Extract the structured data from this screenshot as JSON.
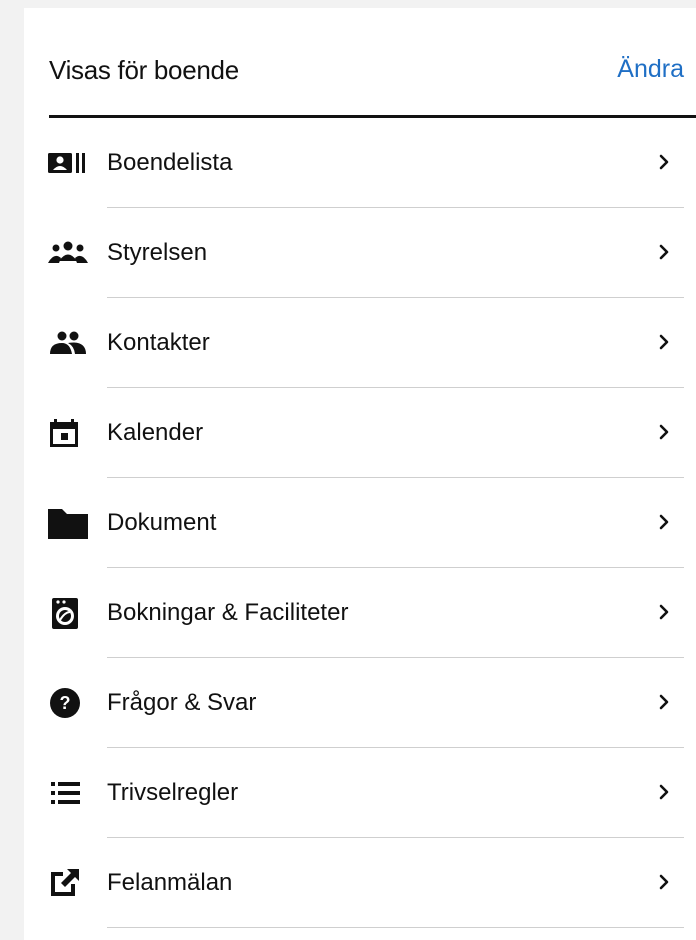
{
  "header": {
    "title": "Visas för boende",
    "action_label": "Ändra"
  },
  "accent_color": "#1f6fc5",
  "menu": [
    {
      "label": "Boendelista",
      "icon": "resident-list-icon"
    },
    {
      "label": "Styrelsen",
      "icon": "board-group-icon"
    },
    {
      "label": "Kontakter",
      "icon": "contacts-people-icon"
    },
    {
      "label": "Kalender",
      "icon": "calendar-icon"
    },
    {
      "label": "Dokument",
      "icon": "folder-icon"
    },
    {
      "label": "Bokningar & Faciliteter",
      "icon": "washing-machine-icon"
    },
    {
      "label": "Frågor & Svar",
      "icon": "help-circle-icon"
    },
    {
      "label": "Trivselregler",
      "icon": "list-icon"
    },
    {
      "label": "Felanmälan",
      "icon": "external-link-icon"
    }
  ]
}
